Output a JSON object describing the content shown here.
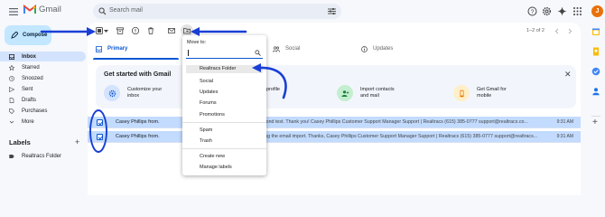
{
  "header": {
    "app_name": "Gmail",
    "search_placeholder": "Search mail",
    "avatar_letter": "J",
    "icons": [
      "menu-icon",
      "search-icon",
      "filter-options-icon",
      "help-icon",
      "settings-icon",
      "gemini-icon",
      "apps-icon"
    ]
  },
  "sidebar": {
    "compose_label": "Compose",
    "items": [
      {
        "label": "Inbox",
        "icon": "inbox-icon"
      },
      {
        "label": "Starred",
        "icon": "star-icon"
      },
      {
        "label": "Snoozed",
        "icon": "clock-icon"
      },
      {
        "label": "Sent",
        "icon": "send-icon"
      },
      {
        "label": "Drafts",
        "icon": "draft-icon"
      },
      {
        "label": "Purchases",
        "icon": "tag-icon"
      },
      {
        "label": "More",
        "icon": "chevron-down-icon"
      }
    ],
    "labels_heading": "Labels",
    "labels": [
      {
        "label": "Realtracs Folder",
        "icon": "label-icon"
      }
    ]
  },
  "toolbar": {
    "pagination": "1–2 of 2",
    "icons": [
      "select-all-checkbox",
      "archive-icon",
      "report-spam-icon",
      "delete-icon",
      "mark-unread-icon",
      "move-to-icon"
    ]
  },
  "tabs": [
    {
      "label": "Primary",
      "icon": "inbox-icon"
    },
    {
      "label": "Social",
      "icon": "people-icon"
    },
    {
      "label": "Updates",
      "icon": "info-icon"
    }
  ],
  "getting_started": {
    "title": "Get started with Gmail",
    "features": [
      {
        "label": "Customize your inbox",
        "line1": "Customize your",
        "line2": "inbox",
        "icon": "settings-icon",
        "color": "#0b57d0"
      },
      {
        "label": "profile",
        "line1": "profile",
        "line2": "",
        "icon": "profile-icon",
        "color": "#0b57d0"
      },
      {
        "label": "Import contacts and mail",
        "line1": "Import contacts",
        "line2": "and mail",
        "icon": "add-person-icon",
        "color": "#188038"
      },
      {
        "label": "Get Gmail for mobile",
        "line1": "Get Gmail for",
        "line2": "mobile",
        "icon": "phone-icon",
        "color": "#e37400"
      }
    ]
  },
  "emails": [
    {
      "from": "Casey Phillips from.",
      "snippet": "cond test. Thank you! Casey Phillips Customer Support Manager Support | Realtracs (615) 385-0777 support@realtracs.co...",
      "time": "9:31 AM"
    },
    {
      "from": "Casey Phillips from.",
      "snippet": "ing the email import. Thanks, Casey Phillips Customer Support Manager Support | Realtracs (615) 385-0777 support@realtracs...",
      "time": "9:31 AM"
    }
  ],
  "move_to_menu": {
    "title": "Move to:",
    "items": [
      "Realtracs Folder",
      "Social",
      "Updates",
      "Forums",
      "Promotions"
    ],
    "system_items": [
      "Spam",
      "Trash"
    ],
    "actions": [
      "Create new",
      "Manage labels"
    ]
  },
  "colors": {
    "accent": "#0b57d0",
    "selected_row": "#c2dbff",
    "annotation_arrow": "#1a3fd6"
  }
}
